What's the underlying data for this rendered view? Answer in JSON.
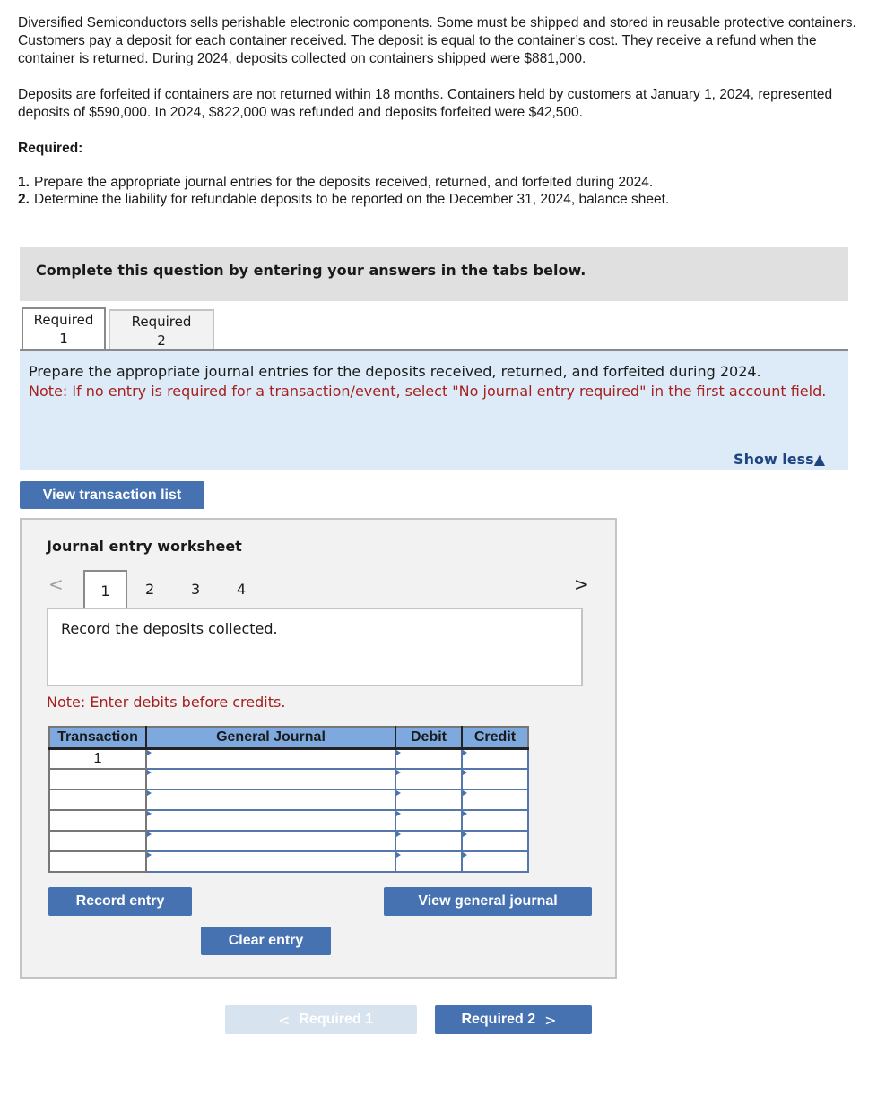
{
  "problem": {
    "paragraph1": "Diversified Semiconductors sells perishable electronic components. Some must be shipped and stored in reusable protective containers. Customers pay a deposit for each container received. The deposit is equal to the container’s cost. They receive a refund when the container is returned. During 2024, deposits collected on containers shipped were $881,000.",
    "paragraph2": "Deposits are forfeited if containers are not returned within 18 months. Containers held by customers at January 1, 2024, represented deposits of $590,000. In 2024, $822,000 was refunded and deposits forfeited were $42,500.",
    "required_heading": "Required:",
    "requirements": [
      {
        "num": "1.",
        "text": "Prepare the appropriate journal entries for the deposits received, returned, and forfeited during 2024."
      },
      {
        "num": "2.",
        "text": "Determine the liability for refundable deposits to be reported on the December 31, 2024, balance sheet."
      }
    ]
  },
  "banner": "Complete this question by entering your answers in the tabs below.",
  "tabs": [
    {
      "line1": "Required",
      "line2": "1",
      "active": true
    },
    {
      "line1": "Required",
      "line2": "2",
      "active": false
    }
  ],
  "instructions": {
    "text": "Prepare the appropriate journal entries for the deposits received, returned, and forfeited during 2024.",
    "note": "Note: If no entry is required for a transaction/event, select \"No journal entry required\" in the first account field.",
    "show_less": "Show less▲"
  },
  "view_transaction_list": "View transaction list",
  "worksheet": {
    "title": "Journal entry worksheet",
    "prev": "<",
    "next": ">",
    "pages": [
      "1",
      "2",
      "3",
      "4"
    ],
    "active_page": "1",
    "description": "Record the deposits collected.",
    "note": "Note: Enter debits before credits.",
    "columns": [
      "Transaction",
      "General Journal",
      "Debit",
      "Credit"
    ],
    "rows": [
      {
        "transaction": "1",
        "account": "",
        "debit": "",
        "credit": ""
      },
      {
        "transaction": "",
        "account": "",
        "debit": "",
        "credit": ""
      },
      {
        "transaction": "",
        "account": "",
        "debit": "",
        "credit": ""
      },
      {
        "transaction": "",
        "account": "",
        "debit": "",
        "credit": ""
      },
      {
        "transaction": "",
        "account": "",
        "debit": "",
        "credit": ""
      },
      {
        "transaction": "",
        "account": "",
        "debit": "",
        "credit": ""
      }
    ],
    "record_entry": "Record entry",
    "clear_entry": "Clear entry",
    "view_general_journal": "View general journal"
  },
  "nav": {
    "prev_label": "Required 1",
    "prev_chevron": "<",
    "next_label": "Required 2",
    "next_chevron": ">"
  }
}
